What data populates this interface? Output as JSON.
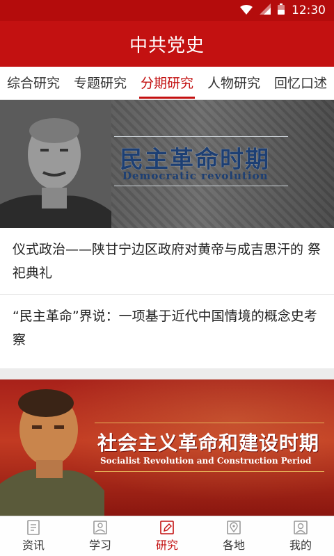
{
  "status_bar": {
    "time": "12:30",
    "icons": [
      "wifi-icon",
      "signal-icon",
      "battery-icon"
    ]
  },
  "app": {
    "title": "中共党史"
  },
  "tabs": [
    {
      "label": "综合研究",
      "active": false
    },
    {
      "label": "专题研究",
      "active": false
    },
    {
      "label": "分期研究",
      "active": true
    },
    {
      "label": "人物研究",
      "active": false
    },
    {
      "label": "回忆口述",
      "active": false
    }
  ],
  "banner1": {
    "title_cn": "民主革命时期",
    "title_en": "Democratic revolution"
  },
  "articles": [
    {
      "title": "仪式政治——陕甘宁边区政府对黄帝与成吉思汗的 祭祀典礼"
    },
    {
      "title": "“民主革命”界说：一项基于近代中国情境的概念史考察"
    }
  ],
  "banner2": {
    "title_cn": "社会主义革命和建设时期",
    "title_en": "Socialist Revolution and Construction Period"
  },
  "bottom_nav": [
    {
      "label": "资讯",
      "icon": "document-icon",
      "active": false
    },
    {
      "label": "学习",
      "icon": "image-icon",
      "active": false
    },
    {
      "label": "研究",
      "icon": "edit-icon",
      "active": true
    },
    {
      "label": "各地",
      "icon": "location-icon",
      "active": false
    },
    {
      "label": "我的",
      "icon": "user-icon",
      "active": false
    }
  ],
  "colors": {
    "primary": "#c31111",
    "statusbar": "#b40c0c"
  }
}
